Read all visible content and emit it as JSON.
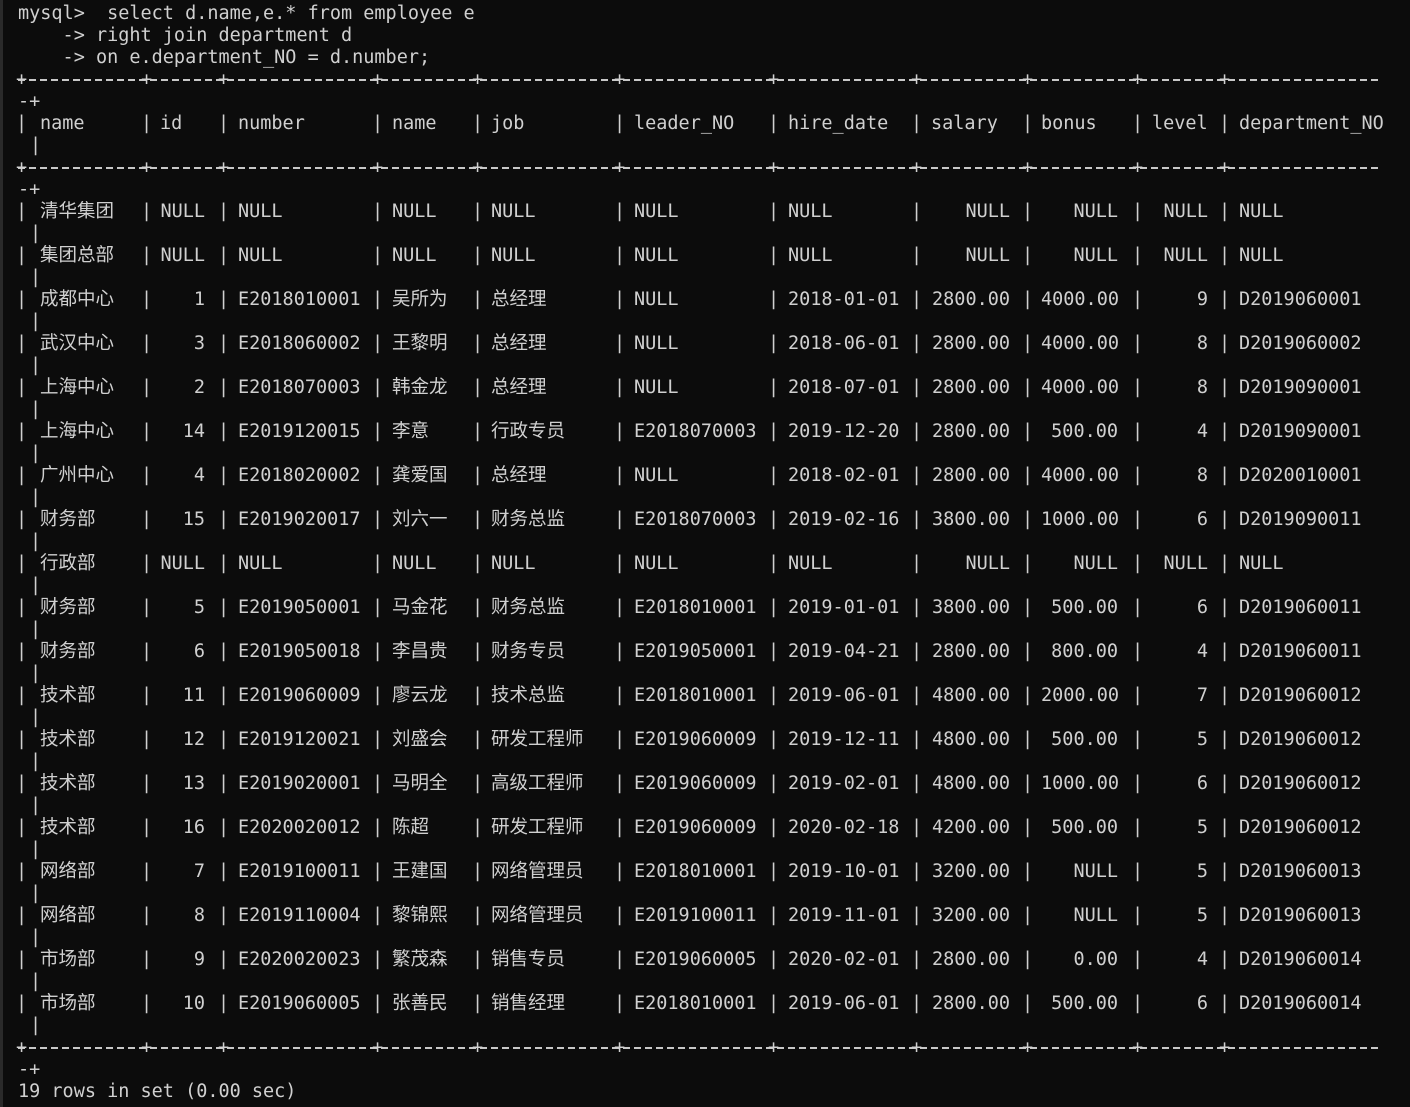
{
  "terminal": {
    "prompt": "mysql>",
    "query_lines": [
      "mysql>  select d.name,e.* from employee e",
      "    -> right join department d",
      "    -> on e.department_NO = d.number;"
    ],
    "wrap_fragment": "-+",
    "vertical_bar": "|",
    "status_line": "19 rows in set (0.00 sec)"
  },
  "table": {
    "columns": [
      "name",
      "id",
      "number",
      "name",
      "job",
      "leader_NO",
      "hire_date",
      "salary",
      "bonus",
      "level",
      "department_NO"
    ],
    "rows": [
      [
        "清华集团",
        "NULL",
        "NULL",
        "NULL",
        "NULL",
        "NULL",
        "NULL",
        "NULL",
        "NULL",
        "NULL",
        "NULL"
      ],
      [
        "集团总部",
        "NULL",
        "NULL",
        "NULL",
        "NULL",
        "NULL",
        "NULL",
        "NULL",
        "NULL",
        "NULL",
        "NULL"
      ],
      [
        "成都中心",
        "1",
        "E2018010001",
        "吴所为",
        "总经理",
        "NULL",
        "2018-01-01",
        "2800.00",
        "4000.00",
        "9",
        "D2019060001"
      ],
      [
        "武汉中心",
        "3",
        "E2018060002",
        "王黎明",
        "总经理",
        "NULL",
        "2018-06-01",
        "2800.00",
        "4000.00",
        "8",
        "D2019060002"
      ],
      [
        "上海中心",
        "2",
        "E2018070003",
        "韩金龙",
        "总经理",
        "NULL",
        "2018-07-01",
        "2800.00",
        "4000.00",
        "8",
        "D2019090001"
      ],
      [
        "上海中心",
        "14",
        "E2019120015",
        "李意",
        "行政专员",
        "E2018070003",
        "2019-12-20",
        "2800.00",
        "500.00",
        "4",
        "D2019090001"
      ],
      [
        "广州中心",
        "4",
        "E2018020002",
        "龚爱国",
        "总经理",
        "NULL",
        "2018-02-01",
        "2800.00",
        "4000.00",
        "8",
        "D2020010001"
      ],
      [
        "财务部",
        "15",
        "E2019020017",
        "刘六一",
        "财务总监",
        "E2018070003",
        "2019-02-16",
        "3800.00",
        "1000.00",
        "6",
        "D2019090011"
      ],
      [
        "行政部",
        "NULL",
        "NULL",
        "NULL",
        "NULL",
        "NULL",
        "NULL",
        "NULL",
        "NULL",
        "NULL",
        "NULL"
      ],
      [
        "财务部",
        "5",
        "E2019050001",
        "马金花",
        "财务总监",
        "E2018010001",
        "2019-01-01",
        "3800.00",
        "500.00",
        "6",
        "D2019060011"
      ],
      [
        "财务部",
        "6",
        "E2019050018",
        "李昌贵",
        "财务专员",
        "E2019050001",
        "2019-04-21",
        "2800.00",
        "800.00",
        "4",
        "D2019060011"
      ],
      [
        "技术部",
        "11",
        "E2019060009",
        "廖云龙",
        "技术总监",
        "E2018010001",
        "2019-06-01",
        "4800.00",
        "2000.00",
        "7",
        "D2019060012"
      ],
      [
        "技术部",
        "12",
        "E2019120021",
        "刘盛会",
        "研发工程师",
        "E2019060009",
        "2019-12-11",
        "4800.00",
        "500.00",
        "5",
        "D2019060012"
      ],
      [
        "技术部",
        "13",
        "E2019020001",
        "马明全",
        "高级工程师",
        "E2019060009",
        "2019-02-01",
        "4800.00",
        "1000.00",
        "6",
        "D2019060012"
      ],
      [
        "技术部",
        "16",
        "E2020020012",
        "陈超",
        "研发工程师",
        "E2019060009",
        "2020-02-18",
        "4200.00",
        "500.00",
        "5",
        "D2019060012"
      ],
      [
        "网络部",
        "7",
        "E2019100011",
        "王建国",
        "网络管理员",
        "E2018010001",
        "2019-10-01",
        "3200.00",
        "NULL",
        "5",
        "D2019060013"
      ],
      [
        "网络部",
        "8",
        "E2019110004",
        "黎锦熙",
        "网络管理员",
        "E2019100011",
        "2019-11-01",
        "3200.00",
        "NULL",
        "5",
        "D2019060013"
      ],
      [
        "市场部",
        "9",
        "E2020020023",
        "繁茂森",
        "销售专员",
        "E2019060005",
        "2020-02-01",
        "2800.00",
        "0.00",
        "4",
        "D2019060014"
      ],
      [
        "市场部",
        "10",
        "E2019060005",
        "张善民",
        "销售经理",
        "E2018010001",
        "2019-06-01",
        "2800.00",
        "500.00",
        "6",
        "D2019060014"
      ]
    ]
  }
}
